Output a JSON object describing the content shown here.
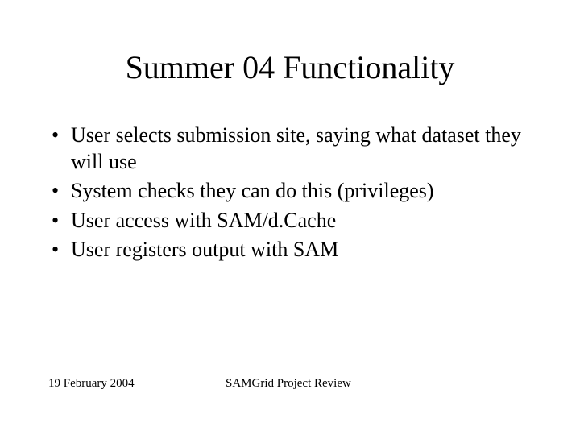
{
  "title": "Summer 04 Functionality",
  "bullets": [
    "User selects submission site, saying what dataset they will use",
    "System checks they can do this (privileges)",
    "User access with SAM/d.Cache",
    "User registers output with SAM"
  ],
  "footer": {
    "date": "19 February 2004",
    "title": "SAMGrid Project Review"
  }
}
